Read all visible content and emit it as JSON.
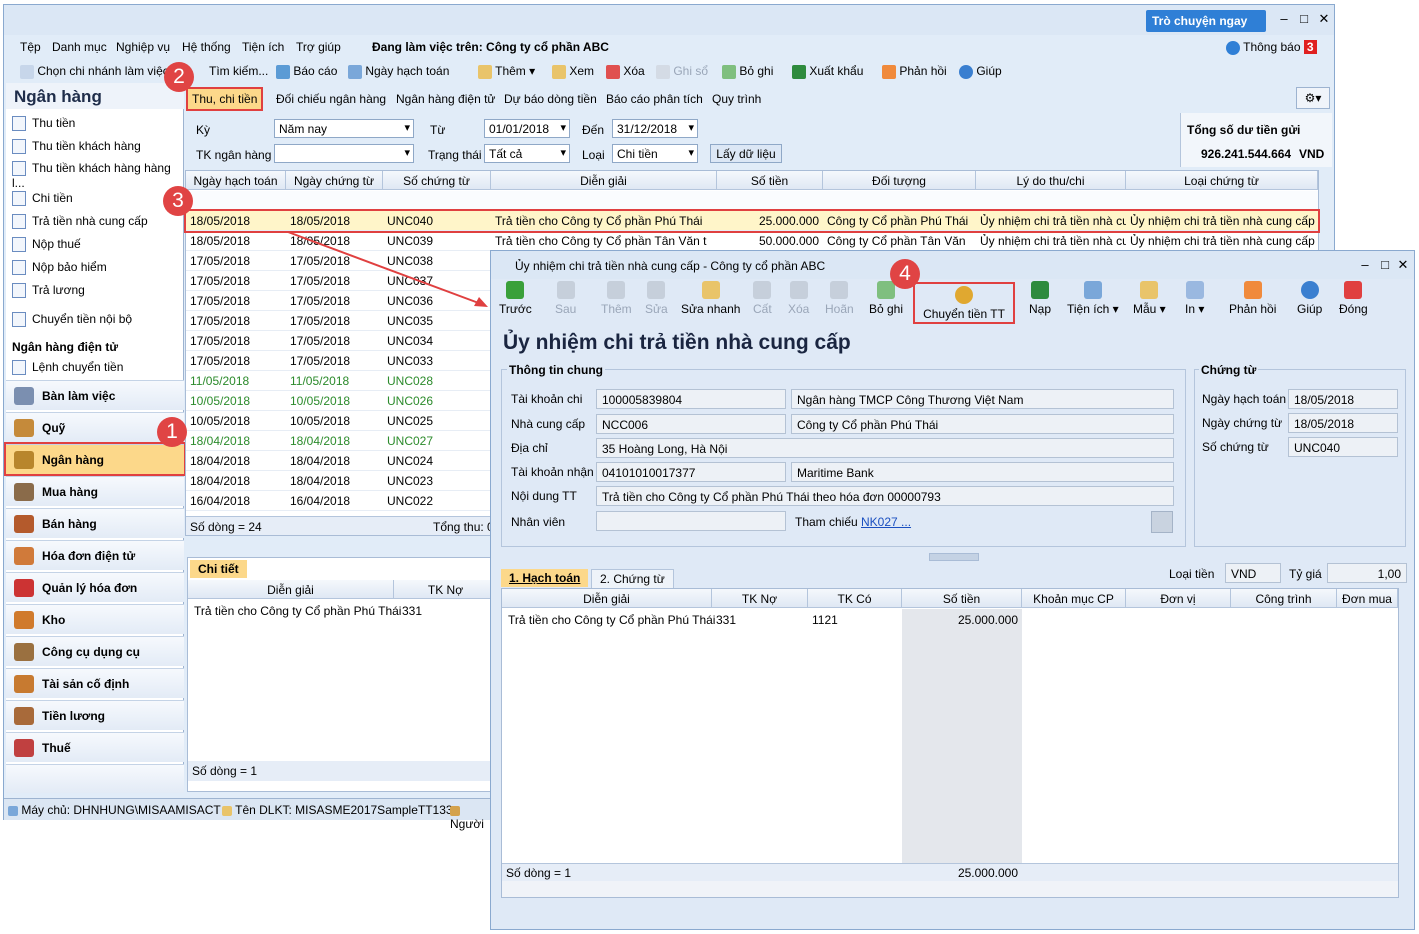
{
  "menu": [
    "Tệp",
    "Danh mục",
    "Nghiệp vụ",
    "Hệ thống",
    "Tiện ích",
    "Trợ giúp"
  ],
  "workspace": "Đang làm việc trên: Công ty cổ phần ABC",
  "chat": "Trò chuyện ngay",
  "notify": "Thông báo",
  "notify_count": "3",
  "toolbar": [
    "Chọn chi nhánh làm việc",
    "Tìm kiếm...",
    "Báo cáo",
    "Ngày hạch toán",
    "Thêm",
    "Xem",
    "Xóa",
    "Ghi sổ",
    "Bỏ ghi",
    "Xuất khẩu",
    "Phản hồi",
    "Giúp"
  ],
  "sidebar": {
    "title": "Ngân hàng",
    "items": [
      "Thu tiền",
      "Thu tiền khách hàng",
      "Thu tiền khách hàng hàng l...",
      "Chi tiền",
      "Trả tiền nhà cung cấp",
      "Nộp thuế",
      "Nộp bảo hiểm",
      "Trả lương",
      "Chuyển tiền nội bộ"
    ],
    "group": "Ngân hàng điện tử",
    "group_item": "Lệnh chuyển tiền",
    "nav": [
      "Bàn làm việc",
      "Quỹ",
      "Ngân hàng",
      "Mua hàng",
      "Bán hàng",
      "Hóa đơn điện tử",
      "Quản lý hóa đơn",
      "Kho",
      "Công cụ dụng cụ",
      "Tài sản cố định",
      "Tiền lương",
      "Thuế"
    ]
  },
  "tabs": [
    "Thu, chi tiền",
    "Đối chiếu ngân hàng",
    "Ngân hàng điện tử",
    "Dự báo dòng tiền",
    "Báo cáo phân tích",
    "Quy trình"
  ],
  "filter": {
    "ky_label": "Kỳ",
    "ky": "Năm nay",
    "tu_label": "Từ",
    "tu": "01/01/2018",
    "den_label": "Đến",
    "den": "31/12/2018",
    "tk_label": "TK ngân hàng",
    "tt_label": "Trạng thái",
    "tt": "Tất cả",
    "loai_label": "Loại",
    "loai": "Chi tiền",
    "btn": "Lấy dữ liệu",
    "total_label": "Tổng số dư tiền gửi",
    "total": "926.241.544.664",
    "cur": "VND"
  },
  "grid": {
    "headers": [
      "Ngày hạch toán",
      "Ngày chứng từ",
      "Số chứng từ",
      "Diễn giải",
      "Số tiền",
      "Đối tượng",
      "Lý do thu/chi",
      "Loại chứng từ"
    ],
    "rows": [
      [
        "18/05/2018",
        "18/05/2018",
        "UNC040",
        "Trả tiền cho Công ty Cổ phần Phú Thái",
        "25.000.000",
        "Công ty Cổ phần Phú Thái",
        "Ủy nhiệm chi trả tiền nhà cu",
        "Ủy nhiệm chi trả tiền nhà cung cấp"
      ],
      [
        "18/05/2018",
        "18/05/2018",
        "UNC039",
        "Trả tiền cho Công ty Cổ phần Tân Văn t",
        "50.000.000",
        "Công ty Cổ phần Tân Văn",
        "Ủy nhiệm chi trả tiền nhà cu",
        "Ủy nhiệm chi trả tiền nhà cung cấp"
      ],
      [
        "17/05/2018",
        "17/05/2018",
        "UNC038"
      ],
      [
        "17/05/2018",
        "17/05/2018",
        "UNC037"
      ],
      [
        "17/05/2018",
        "17/05/2018",
        "UNC036"
      ],
      [
        "17/05/2018",
        "17/05/2018",
        "UNC035"
      ],
      [
        "17/05/2018",
        "17/05/2018",
        "UNC034"
      ],
      [
        "17/05/2018",
        "17/05/2018",
        "UNC033"
      ],
      [
        "11/05/2018",
        "11/05/2018",
        "UNC028"
      ],
      [
        "10/05/2018",
        "10/05/2018",
        "UNC026"
      ],
      [
        "10/05/2018",
        "10/05/2018",
        "UNC025"
      ],
      [
        "18/04/2018",
        "18/04/2018",
        "UNC027"
      ],
      [
        "18/04/2018",
        "18/04/2018",
        "UNC024"
      ],
      [
        "18/04/2018",
        "18/04/2018",
        "UNC023"
      ],
      [
        "16/04/2018",
        "16/04/2018",
        "UNC022"
      ]
    ],
    "count": "Số dòng = 24",
    "sum": "Tổng thu: 0"
  },
  "detail": {
    "tab": "Chi tiết",
    "h1": "Diễn giải",
    "h2": "TK Nợ",
    "row": "Trả tiền cho Công ty Cổ phần Phú Thái",
    "tk": "331",
    "count": "Số dòng = 1"
  },
  "status": {
    "server": "Máy chủ: DHNHUNG\\MISAAMISACT",
    "db": "Tên DLKT: MISASME2017SampleTT133",
    "user": "Người"
  },
  "dialog": {
    "title": "Ủy nhiệm chi trả tiền nhà cung cấp - Công ty cổ phần ABC",
    "buttons": [
      "Trước",
      "Sau",
      "Thêm",
      "Sửa",
      "Sửa nhanh",
      "Cất",
      "Xóa",
      "Hoãn",
      "Bỏ ghi",
      "Chuyển tiền TT",
      "Nạp",
      "Tiện ích",
      "Mẫu",
      "In",
      "Phản hồi",
      "Giúp",
      "Đóng"
    ],
    "heading": "Ủy nhiệm chi trả tiền nhà cung cấp",
    "sec1": "Thông tin chung",
    "sec2": "Chứng từ",
    "labels": [
      "Tài khoản chi",
      "Nhà cung cấp",
      "Địa chỉ",
      "Tài khoản nhận",
      "Nội dung TT",
      "Nhân viên"
    ],
    "tkchi": "100005839804",
    "bank": "Ngân hàng TMCP Công Thương Việt Nam",
    "ncc": "NCC006",
    "ncc_name": "Công ty Cổ phần Phú Thái",
    "addr": "35 Hoàng Long, Hà Nội",
    "tknhan": "04101010017377",
    "bank2": "Maritime Bank",
    "content": "Trả tiền cho Công ty Cổ phần Phú Thái theo hóa đơn 00000793",
    "ref_label": "Tham chiếu",
    "ref": "NK027 ...",
    "ct_labels": [
      "Ngày hạch toán",
      "Ngày chứng từ",
      "Số chứng từ"
    ],
    "ct": [
      "18/05/2018",
      "18/05/2018",
      "UNC040"
    ],
    "tab1": "1. Hạch toán",
    "tab2": "2. Chứng từ",
    "loaitien_label": "Loại tiền",
    "loaitien": "VND",
    "tygia_label": "Tỷ giá",
    "tygia": "1,00",
    "gh": [
      "Diễn giải",
      "TK Nợ",
      "TK Có",
      "Số tiền",
      "Khoản mục CP",
      "Đơn vị",
      "Công trình",
      "Đơn mua"
    ],
    "row": [
      "Trả tiền cho Công ty Cổ phần Phú Thái",
      "331",
      "1121",
      "25.000.000"
    ],
    "count": "Số dòng = 1",
    "sum": "25.000.000"
  },
  "steps": [
    "1",
    "2",
    "3",
    "4"
  ]
}
